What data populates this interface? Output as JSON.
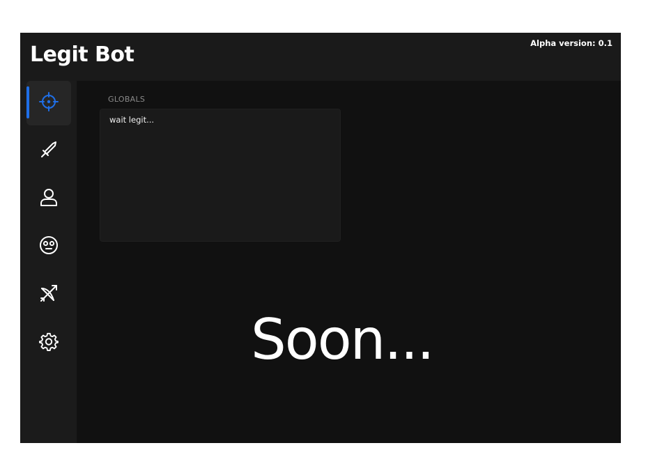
{
  "app": {
    "title": "Legit Bot",
    "version": "Alpha version: 0.1"
  },
  "sidebar": {
    "items": [
      {
        "icon": "crosshair-icon",
        "active": true
      },
      {
        "icon": "sword-icon",
        "active": false
      },
      {
        "icon": "user-icon",
        "active": false
      },
      {
        "icon": "face-icon",
        "active": false
      },
      {
        "icon": "bow-arrow-icon",
        "active": false
      },
      {
        "icon": "gear-icon",
        "active": false
      }
    ]
  },
  "main": {
    "section_label": "GLOBALS",
    "globals_text": "wait legit...",
    "placeholder": "Soon..."
  },
  "colors": {
    "accent": "#1f6fe8",
    "background": "#111111",
    "sidebar": "#1b1b1b",
    "titlebar": "#1a1a1a"
  }
}
